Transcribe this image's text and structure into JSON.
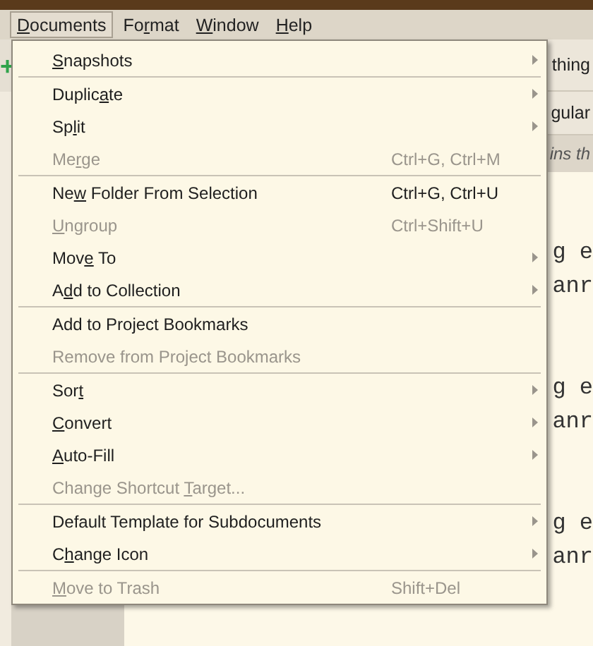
{
  "menubar": [
    {
      "key": "D",
      "post": "ocuments",
      "selected": true
    },
    {
      "pre": "Fo",
      "key": "r",
      "post": "mat",
      "selected": false
    },
    {
      "key": "W",
      "post": "indow",
      "selected": false
    },
    {
      "key": "H",
      "post": "elp",
      "selected": false
    }
  ],
  "background": {
    "add_button": "+",
    "header_text": "thing",
    "format_text": "gular",
    "hint_text": "ins th",
    "editor_lines": [
      {
        "text": "g e"
      },
      {
        "text": "anr"
      },
      {
        "text": "g e"
      },
      {
        "text": "anr"
      },
      {
        "text": "g e"
      },
      {
        "text": "anr"
      }
    ]
  },
  "menu": {
    "items": [
      {
        "kind": "item",
        "key": "S",
        "post": "napshots",
        "disabled": false,
        "submenu": true
      },
      {
        "kind": "separator"
      },
      {
        "kind": "item",
        "pre": "Duplic",
        "key": "a",
        "post": "te",
        "disabled": false,
        "submenu": true
      },
      {
        "kind": "item",
        "pre": "Sp",
        "key": "l",
        "post": "it",
        "disabled": false,
        "submenu": true
      },
      {
        "kind": "item",
        "pre": "Me",
        "key": "r",
        "post": "ge",
        "disabled": true,
        "shortcut": "Ctrl+G, Ctrl+M"
      },
      {
        "kind": "separator"
      },
      {
        "kind": "item",
        "pre": "Ne",
        "key": "w",
        "post": " Folder From Selection",
        "disabled": false,
        "shortcut": "Ctrl+G, Ctrl+U"
      },
      {
        "kind": "item",
        "key": "U",
        "post": "ngroup",
        "disabled": true,
        "shortcut": "Ctrl+Shift+U"
      },
      {
        "kind": "item",
        "pre": "Mov",
        "key": "e",
        "post": " To",
        "disabled": false,
        "submenu": true
      },
      {
        "kind": "item",
        "pre": "A",
        "key": "d",
        "post": "d to Collection",
        "disabled": false,
        "submenu": true
      },
      {
        "kind": "separator"
      },
      {
        "kind": "item",
        "pre": "Add to Project Bookmarks",
        "disabled": false
      },
      {
        "kind": "item",
        "pre": "Remove from Project Bookmarks",
        "disabled": true
      },
      {
        "kind": "separator"
      },
      {
        "kind": "item",
        "pre": "Sor",
        "key": "t",
        "disabled": false,
        "submenu": true
      },
      {
        "kind": "item",
        "key": "C",
        "post": "onvert",
        "disabled": false,
        "submenu": true
      },
      {
        "kind": "item",
        "key": "A",
        "post": "uto-Fill",
        "disabled": false,
        "submenu": true
      },
      {
        "kind": "item",
        "pre": "Change Shortcut ",
        "key": "T",
        "post": "arget...",
        "disabled": true
      },
      {
        "kind": "separator"
      },
      {
        "kind": "item",
        "pre": "Default Template for Subdocuments",
        "disabled": false,
        "submenu": true
      },
      {
        "kind": "item",
        "pre": "C",
        "key": "h",
        "post": "ange Icon",
        "disabled": false,
        "submenu": true
      },
      {
        "kind": "separator"
      },
      {
        "kind": "item",
        "key": "M",
        "post": "ove to Trash",
        "disabled": true,
        "shortcut": "Shift+Del"
      }
    ]
  }
}
